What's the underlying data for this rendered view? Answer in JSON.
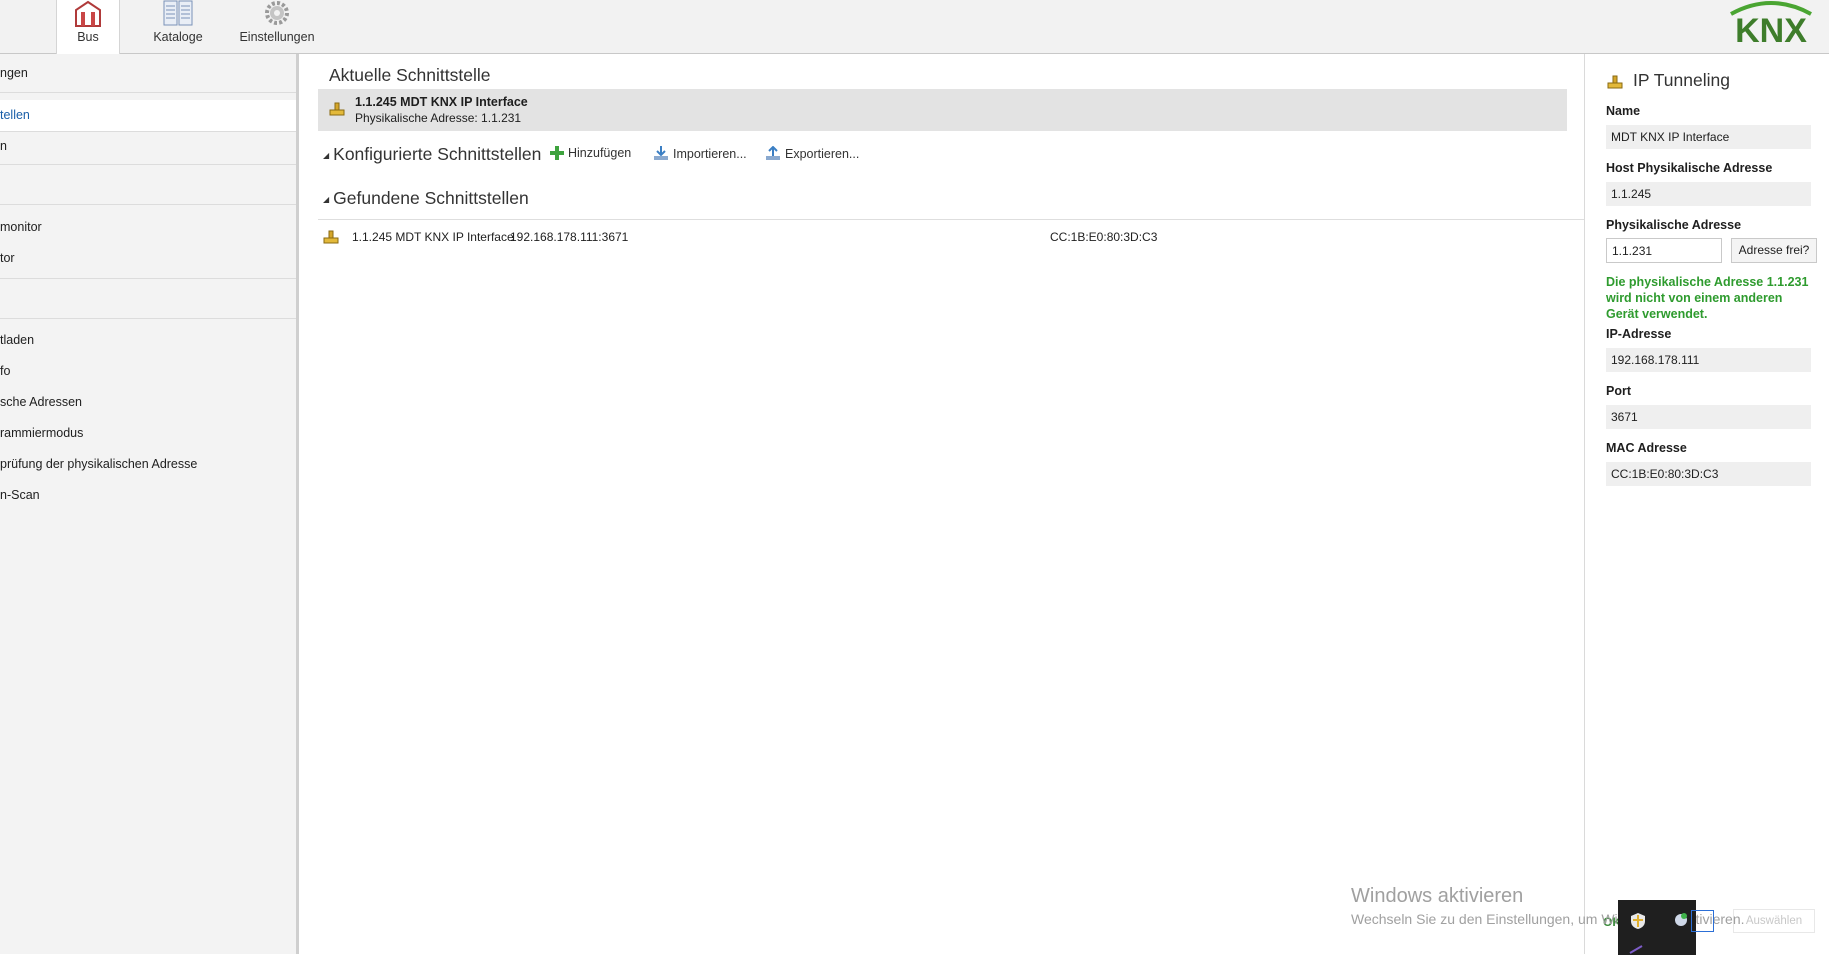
{
  "ribbon": {
    "tabs": [
      {
        "label": "Bus",
        "icon": "house-bus-icon",
        "active": true
      },
      {
        "label": "Kataloge",
        "icon": "catalog-icon",
        "active": false
      },
      {
        "label": "Einstellungen",
        "icon": "gear-icon",
        "active": false
      }
    ],
    "logo_text": "KNX",
    "logo_color": "#4aa532",
    "logo_text_color": "#4a4a4a"
  },
  "sidebar": {
    "items": [
      {
        "label": "ngen"
      },
      {
        "label": "tellen",
        "active": true
      },
      {
        "label": "n"
      },
      {
        "label": "monitor"
      },
      {
        "label": "tor"
      },
      {
        "label": "tladen"
      },
      {
        "label": "fo"
      },
      {
        "label": "sche Adressen"
      },
      {
        "label": "rammiermodus"
      },
      {
        "label": "prüfung der physikalischen Adresse"
      },
      {
        "label": "n-Scan"
      }
    ],
    "active_color": "#1a5fa8"
  },
  "main": {
    "current_title": "Aktuelle Schnittstelle",
    "current_interface": {
      "name": "1.1.245 MDT KNX IP Interface",
      "address": "Physikalische Adresse: 1.1.231",
      "icon": "network-interface-icon"
    },
    "configured_title": "Konfigurierte Schnittstellen",
    "actions": [
      {
        "label": "Hinzufügen",
        "icon": "plus-icon"
      },
      {
        "label": "Importieren...",
        "icon": "import-icon"
      },
      {
        "label": "Exportieren...",
        "icon": "export-icon"
      }
    ],
    "found_title": "Gefundene Schnittstellen",
    "found_interfaces": [
      {
        "name": "1.1.245 MDT KNX IP Interface",
        "ip": "192.168.178.111:3671",
        "mac": "CC:1B:E0:80:3D:C3"
      }
    ]
  },
  "right_panel": {
    "title": "IP Tunneling",
    "fields": {
      "name_label": "Name",
      "name_value": "MDT KNX IP Interface",
      "host_label": "Host Physikalische Adresse",
      "host_value": "1.1.245",
      "phys_label": "Physikalische Adresse",
      "phys_value": "1.1.231",
      "check_button": "Adresse frei?",
      "status": "Die physikalische Adresse 1.1.231 wird nicht von einem anderen Gerät verwendet.",
      "ip_label": "IP-Adresse",
      "ip_value": "192.168.178.111",
      "port_label": "Port",
      "port_value": "3671",
      "mac_label": "MAC Adresse",
      "mac_value": "CC:1B:E0:80:3D:C3"
    },
    "ok_label": "OK",
    "select_label": "Auswählen",
    "status_color": "#2e9b2e"
  },
  "watermark": {
    "title": "Windows aktivieren",
    "subtitle": "Wechseln Sie zu den Einstellungen, um Windows zu aktivieren."
  }
}
